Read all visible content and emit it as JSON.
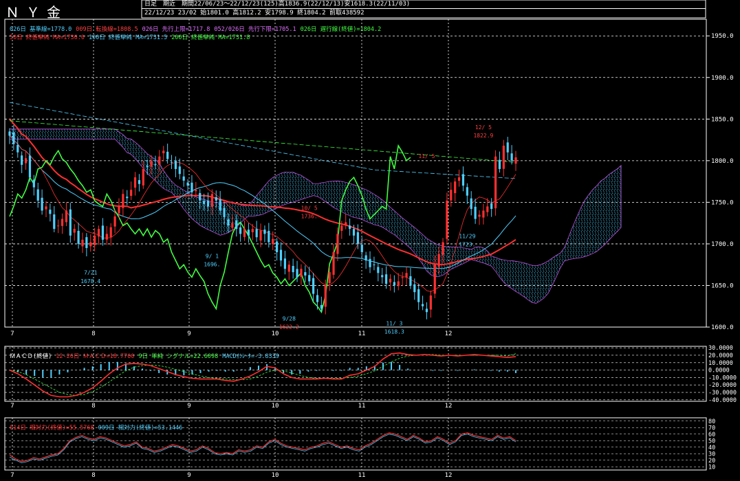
{
  "header": {
    "title": "ＮＹ金",
    "info1": "日足　期近　期間22/06/23～22/12/23(125)高1836.9(22/12/13)安1618.3(22/11/03)",
    "info2": "22/12/23 23/02 始1801.0 高1812.2 安1798.9 終1804.2 前取438592"
  },
  "legend": {
    "line1": [
      {
        "text": "026日 基準線=1778.0",
        "color": "#4fd0ff"
      },
      {
        "text": "009日 転換線=1808.5",
        "color": "#ff4040"
      },
      {
        "text": "026日 先行上限=1717.8",
        "color": "#e070ff"
      },
      {
        "text": "052/026日 先行下限=1705.1",
        "color": "#e070ff"
      },
      {
        "text": "026日 遅行線(終値)=1804.2",
        "color": "#40ff40"
      }
    ],
    "line2": [
      {
        "text": "50日 終値単純 MA=1736.0",
        "color": "#ff3030"
      },
      {
        "text": "100日 終値単純 MA=1731.5",
        "color": "#4fd0ff"
      },
      {
        "text": "200日 終値単純 MA=1731.8",
        "color": "#40ff40"
      }
    ],
    "macd": [
      {
        "text": "ＭＡＣＤ(終値)",
        "color": "#ffffff"
      },
      {
        "text": "12-26日 ＭＡＣＤ=18.7760",
        "color": "#ff3030"
      },
      {
        "text": "9日 単純 シグナル=22.6098",
        "color": "#40ff40"
      },
      {
        "text": "MACDｵｼﾚｰﾀ=-3.8339",
        "color": "#4fd0ff"
      }
    ],
    "rsi": [
      {
        "text": "014日 相対力(終値)=55.5768",
        "color": "#ff3030"
      },
      {
        "text": "009日 相対力(終値)=53.1446",
        "color": "#4fd0ff"
      }
    ]
  },
  "annotations": [
    {
      "text": "7/21",
      "color": "#4fd0ff",
      "date": "7/21",
      "price": 1663
    },
    {
      "text": "1678.4",
      "color": "#4fd0ff",
      "date": "7/21",
      "price": 1653
    },
    {
      "text": "9/28",
      "color": "#4fd0ff",
      "date": "9/28",
      "price": 1608
    },
    {
      "text": "1622.2",
      "color": "#ff4040",
      "date": "9/28",
      "price": 1598
    },
    {
      "text": "11/ 3",
      "color": "#4fd0ff",
      "date": "11/3",
      "price": 1602
    },
    {
      "text": "1618.3",
      "color": "#4fd0ff",
      "date": "11/3",
      "price": 1592
    },
    {
      "text": "12/ 5",
      "color": "#ff4040",
      "date": "12/5",
      "price": 1838
    },
    {
      "text": "1822.9",
      "color": "#ff4040",
      "date": "12/5",
      "price": 1828
    },
    {
      "text": "9/ 1",
      "color": "#4fd0ff",
      "date": "9/1",
      "price": 1683
    },
    {
      "text": "1696.",
      "color": "#4fd0ff",
      "date": "9/1",
      "price": 1673
    },
    {
      "text": "10/ 5",
      "color": "#ff4040",
      "date": "10/5",
      "price": 1741
    },
    {
      "text": "1736.",
      "color": "#ff4040",
      "date": "10/5",
      "price": 1731
    },
    {
      "text": "11/ 5",
      "color": "#ff4040",
      "date": "11/15",
      "price": 1803
    },
    {
      "text": "11/29",
      "color": "#4fd0ff",
      "date": "11/29",
      "price": 1707
    },
    {
      "text": "1723.",
      "color": "#4fd0ff",
      "date": "11/29",
      "price": 1697
    }
  ],
  "chart_data": [
    {
      "type": "candlestick",
      "name": "price",
      "ylim": [
        1600,
        1970
      ],
      "yticks": [
        1600,
        1650,
        1700,
        1750,
        1800,
        1850,
        1900,
        1950
      ],
      "ytick_labels": [
        "1600.0",
        "1650.0",
        "1700.0",
        "1750.0",
        "1800.0",
        "1850.0",
        "1900.0",
        "1950.0"
      ],
      "xtick_labels": [
        "7",
        "8",
        "9",
        "10",
        "11",
        "12"
      ],
      "x_axis": "2022-06-23 to 2022-12-23, daily",
      "ohlc_close": [
        1830,
        1820,
        1810,
        1795,
        1803,
        1780,
        1768,
        1752,
        1740,
        1745,
        1736,
        1718,
        1722,
        1730,
        1740,
        1710,
        1718,
        1700,
        1705,
        1695,
        1702,
        1710,
        1718,
        1705,
        1712,
        1720,
        1733,
        1745,
        1760,
        1755,
        1765,
        1780,
        1772,
        1790,
        1792,
        1800,
        1795,
        1805,
        1812,
        1802,
        1798,
        1790,
        1784,
        1776,
        1770,
        1762,
        1765,
        1752,
        1748,
        1745,
        1760,
        1752,
        1740,
        1732,
        1722,
        1725,
        1718,
        1712,
        1718,
        1710,
        1718,
        1708,
        1716,
        1712,
        1702,
        1706,
        1690,
        1680,
        1670,
        1675,
        1666,
        1660,
        1670,
        1662,
        1655,
        1640,
        1630,
        1622,
        1650,
        1666,
        1690,
        1712,
        1722,
        1726,
        1718,
        1710,
        1700,
        1690,
        1680,
        1672,
        1675,
        1665,
        1660,
        1652,
        1658,
        1650,
        1655,
        1660,
        1665,
        1650,
        1642,
        1630,
        1625,
        1618,
        1638,
        1676,
        1688,
        1702,
        1752,
        1765,
        1775,
        1780,
        1770,
        1758,
        1742,
        1730,
        1735,
        1740,
        1745,
        1742,
        1805,
        1790,
        1818,
        1810,
        1800,
        1804
      ]
    },
    {
      "type": "line",
      "name": "MACD",
      "ylim": [
        -42,
        32
      ],
      "yticks": [
        30,
        20,
        10,
        0,
        -10,
        -20,
        -30,
        -40
      ],
      "ytick_labels": [
        "30.0000",
        "20.0000",
        "10.0000",
        "0.0000",
        "-10.0000",
        "-20.0000",
        "-30.0000",
        "-40.0000"
      ],
      "series": [
        {
          "name": "ＭＡＣＤ",
          "values": [
            0,
            -5,
            -12,
            -20,
            -28,
            -34,
            -36,
            -36,
            -34,
            -30,
            -24,
            -15,
            -5,
            3,
            8,
            9,
            8,
            6,
            2,
            -2,
            -6,
            -9,
            -11,
            -12,
            -12,
            -12,
            -14,
            -15,
            -12,
            -8,
            -2,
            5,
            3,
            -5,
            -10,
            -12,
            -12,
            -12,
            -11,
            -12,
            -12,
            -7,
            -5,
            0,
            5,
            15,
            22,
            23,
            21,
            20,
            21,
            20,
            19,
            20,
            19,
            20,
            21,
            20,
            19,
            18,
            17,
            18
          ]
        },
        {
          "name": "シグナル",
          "values": [
            0,
            -2,
            -6,
            -12,
            -18,
            -24,
            -30,
            -33,
            -34,
            -33,
            -29,
            -23,
            -16,
            -8,
            -1,
            4,
            6,
            7,
            6,
            4,
            1,
            -2,
            -5,
            -8,
            -10,
            -11,
            -12,
            -13,
            -13,
            -12,
            -8,
            -3,
            0,
            -1,
            -4,
            -7,
            -10,
            -11,
            -11,
            -11,
            -11,
            -10,
            -8,
            -5,
            -1,
            5,
            11,
            16,
            19,
            20,
            21,
            21,
            20,
            20,
            20,
            20,
            20,
            20,
            20,
            20,
            19,
            22
          ]
        },
        {
          "name": "MACDｵｼﾚｰﾀ",
          "values": [
            0,
            -3,
            -6,
            -8,
            -10,
            -10,
            -6,
            -3,
            0,
            3,
            5,
            8,
            11,
            11,
            9,
            5,
            2,
            -1,
            -4,
            -6,
            -7,
            -7,
            -6,
            -4,
            -2,
            -1,
            -2,
            -2,
            1,
            4,
            6,
            8,
            3,
            -4,
            -6,
            -5,
            -2,
            -1,
            0,
            -1,
            -1,
            3,
            3,
            5,
            6,
            10,
            11,
            7,
            2,
            0,
            0,
            -1,
            -1,
            0,
            -1,
            0,
            1,
            0,
            -1,
            -2,
            -2,
            -4
          ]
        }
      ]
    },
    {
      "type": "line",
      "name": "RSI",
      "ylim": [
        5,
        85
      ],
      "yticks": [
        80,
        70,
        60,
        50,
        40,
        30,
        20,
        10
      ],
      "ytick_labels": [
        "80",
        "70",
        "60",
        "50",
        "40",
        "30",
        "20",
        "10"
      ],
      "series": [
        {
          "name": "014日 相対力",
          "values": [
            28,
            22,
            18,
            20,
            24,
            22,
            25,
            28,
            30,
            38,
            50,
            55,
            58,
            54,
            52,
            56,
            54,
            50,
            46,
            42,
            44,
            48,
            40,
            38,
            34,
            36,
            40,
            44,
            42,
            38,
            34,
            36,
            42,
            38,
            32,
            30,
            32,
            30,
            36,
            34,
            36,
            42,
            40,
            48,
            52,
            46,
            42,
            40,
            38,
            36,
            40,
            42,
            46,
            48,
            44,
            40,
            42,
            38,
            36,
            42,
            46,
            52,
            58,
            62,
            60,
            56,
            52,
            58,
            54,
            48,
            50,
            56,
            52,
            46,
            50,
            60,
            62,
            58,
            56,
            54,
            52,
            58,
            54,
            56,
            50
          ]
        },
        {
          "name": "009日 相対力",
          "values": [
            25,
            20,
            16,
            18,
            22,
            20,
            23,
            26,
            28,
            36,
            48,
            53,
            56,
            52,
            50,
            54,
            52,
            48,
            44,
            40,
            42,
            46,
            38,
            36,
            32,
            34,
            38,
            42,
            40,
            36,
            32,
            34,
            40,
            36,
            30,
            28,
            30,
            28,
            34,
            32,
            34,
            40,
            38,
            46,
            50,
            44,
            40,
            38,
            36,
            34,
            38,
            40,
            44,
            46,
            42,
            38,
            40,
            36,
            34,
            40,
            44,
            50,
            56,
            60,
            58,
            54,
            50,
            56,
            52,
            46,
            48,
            54,
            50,
            44,
            48,
            58,
            60,
            56,
            54,
            52,
            50,
            56,
            52,
            54,
            48
          ]
        }
      ]
    }
  ]
}
